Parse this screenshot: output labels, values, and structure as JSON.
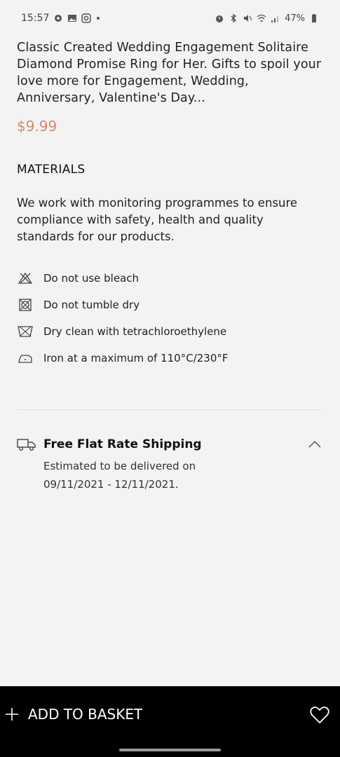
{
  "status_bar": {
    "time": "15:57",
    "battery": "47%",
    "left_icons": [
      "settings-gear-icon",
      "gallery-icon",
      "instagram-icon",
      "dot-icon"
    ],
    "right_icons": [
      "alarm-icon",
      "bluetooth-icon",
      "mute-icon",
      "wifi-icon",
      "signal-icon",
      "battery-icon"
    ]
  },
  "product": {
    "title": "Classic Created Wedding Engagement Solitaire Diamond Promise Ring for Her. Gifts to spoil your love more for Engagement, Wedding, Anniversary, Valentine's Day...",
    "price": "$9.99"
  },
  "materials": {
    "heading": "MATERIALS",
    "text": "We work with monitoring programmes to ensure compliance with safety, health and quality standards for our products.",
    "care": [
      {
        "icon": "no-bleach-icon",
        "label": "Do not use bleach"
      },
      {
        "icon": "no-tumble-dry-icon",
        "label": "Do not tumble dry"
      },
      {
        "icon": "dry-clean-icon",
        "label": "Dry clean with tetrachloroethylene"
      },
      {
        "icon": "iron-icon",
        "label": "Iron at a maximum of 110°C/230°F"
      }
    ]
  },
  "shipping": {
    "title": "Free Flat Rate Shipping",
    "line1": "Estimated to be delivered on",
    "line2": "09/11/2021 - 12/11/2021."
  },
  "actions": {
    "add_to_basket": "ADD TO BASKET"
  },
  "colors": {
    "price": "#cf8b6c",
    "background": "#f3f3f3",
    "bottom_bar": "#000000"
  }
}
